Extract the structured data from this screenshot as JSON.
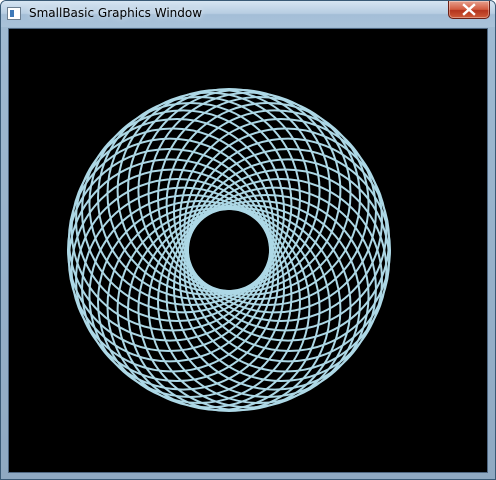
{
  "window": {
    "title": "SmallBasic Graphics Window",
    "title_icon": "smallbasic-window-icon",
    "close_icon": "close-icon"
  },
  "canvas": {
    "background_color": "#000000",
    "pen_color": "#add8e6",
    "circle_count": 36
  },
  "colors": {
    "titlebar": "#b7cde2",
    "close_button": "#c7432a",
    "frame": "#9fbad2"
  }
}
